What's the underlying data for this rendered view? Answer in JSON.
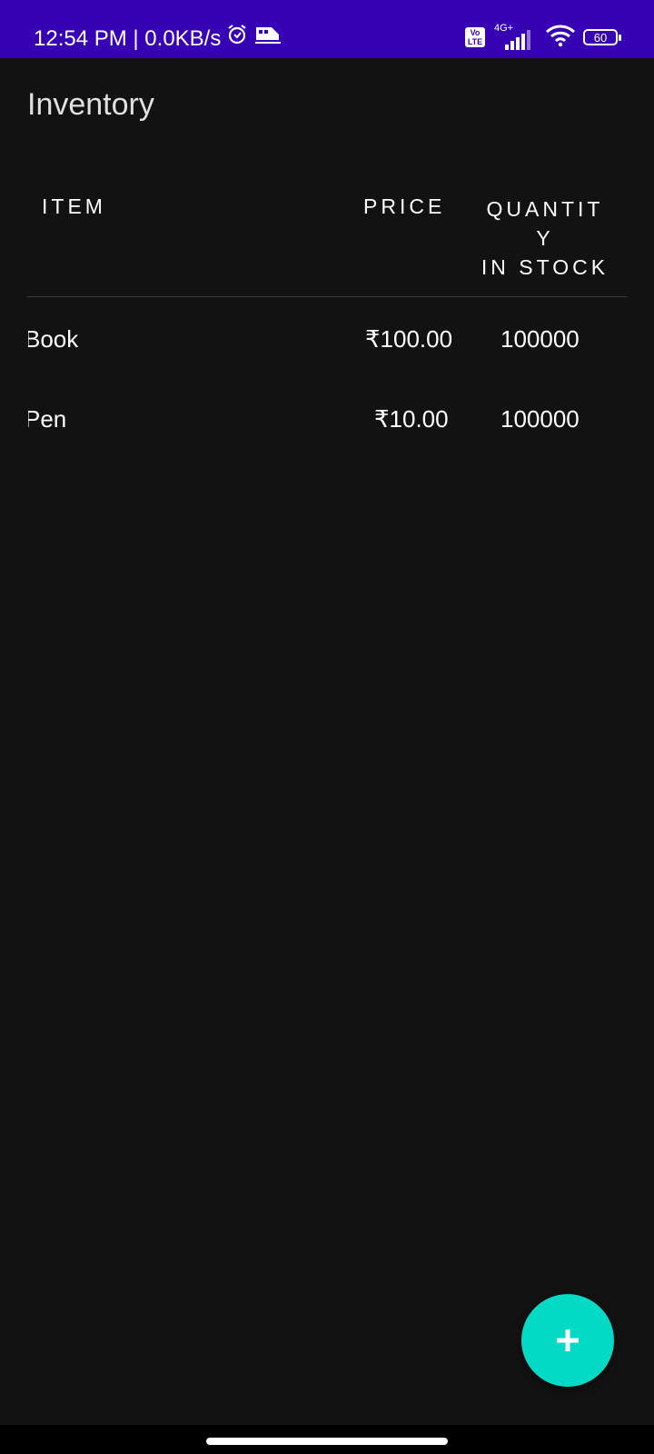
{
  "status_bar": {
    "time": "12:54 PM | 0.0KB/s",
    "network_type": "4G+",
    "volte_label_1": "Vo",
    "volte_label_2": "LTE",
    "battery": "60",
    "background_color": "#3700b3"
  },
  "app_bar": {
    "title": "Inventory"
  },
  "table": {
    "headers": {
      "item": "ITEM",
      "price": "PRICE",
      "quantity_line_1": "QUANTIT",
      "quantity_line_2": "Y",
      "quantity_line_3": "IN STOCK"
    },
    "rows": [
      {
        "item": "Book",
        "price": "₹100.00",
        "quantity": "100000"
      },
      {
        "item": "Pen",
        "price": "₹10.00",
        "quantity": "100000"
      }
    ]
  },
  "fab": {
    "icon": "plus-icon",
    "color": "#03dac5"
  },
  "colors": {
    "background": "#121212",
    "text": "#ffffff"
  }
}
